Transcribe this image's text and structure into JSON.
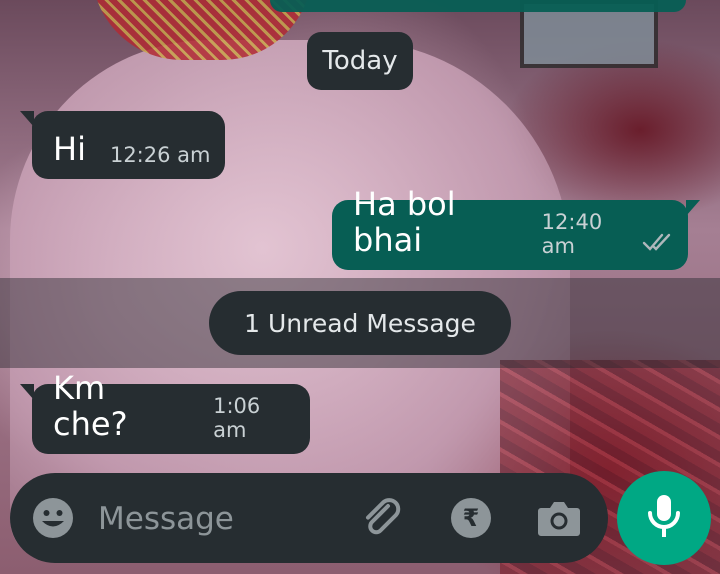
{
  "chat": {
    "date_chip": "Today",
    "messages": [
      {
        "direction": "incoming",
        "text": "Hi",
        "time": "12:26 am"
      },
      {
        "direction": "outgoing",
        "text": "Ha bol bhai",
        "time": "12:40 am",
        "status": "read-double-check-icon"
      },
      {
        "direction": "incoming",
        "text": "Km che?",
        "time": "1:06 am"
      }
    ],
    "unread_label": "1 Unread Message"
  },
  "composer": {
    "placeholder": "Message",
    "value": "",
    "icons": [
      "emoji-icon",
      "attachment-icon",
      "rupee-payment-icon",
      "camera-icon",
      "mic-icon"
    ]
  },
  "colors": {
    "incoming_bubble": "#262d31",
    "outgoing_bubble": "#075e54",
    "mic_button": "#00a884",
    "icon_gray": "#8d9599"
  }
}
